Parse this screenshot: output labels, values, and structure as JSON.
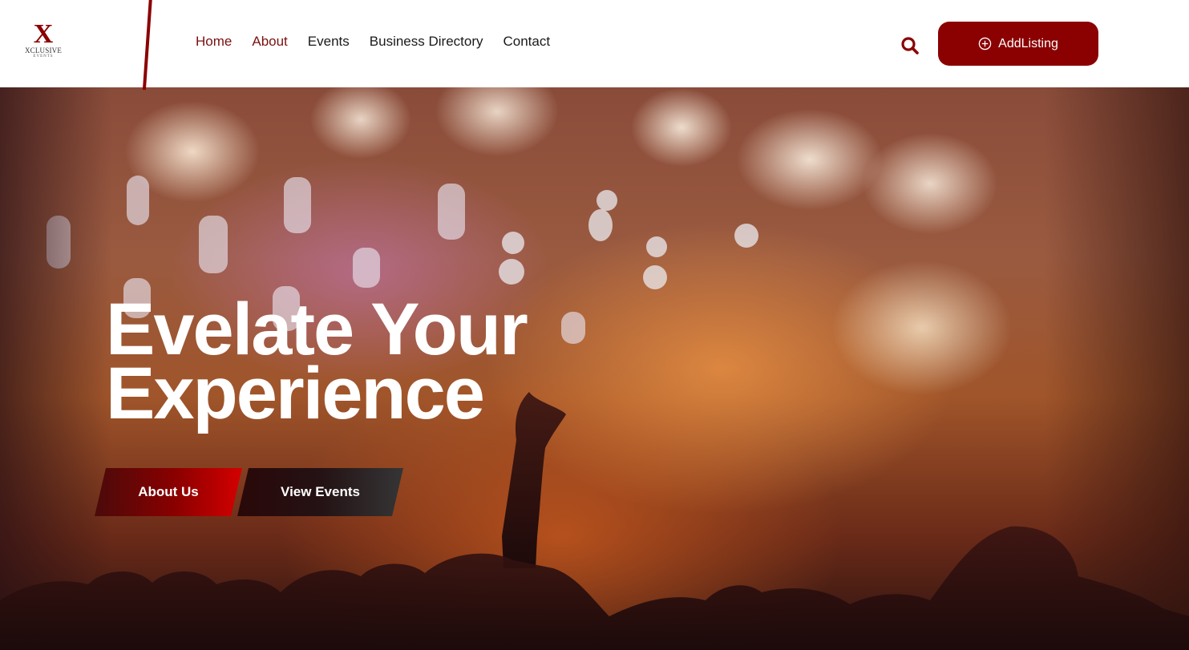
{
  "brand": {
    "logo_letter": "X",
    "logo_name": "XCLUSIVE",
    "logo_sub": "EVENTS",
    "accent_color": "#8b0000"
  },
  "nav": {
    "items": [
      {
        "label": "Home"
      },
      {
        "label": "About"
      },
      {
        "label": "Events"
      },
      {
        "label": "Business Directory"
      },
      {
        "label": "Contact"
      }
    ]
  },
  "header_actions": {
    "search_icon": "search-icon",
    "add_listing_label": "AddListing",
    "add_listing_icon": "plus-circle-icon"
  },
  "hero": {
    "title_line1": "Evelate Your",
    "title_line2": "Experience",
    "primary_button": "About Us",
    "secondary_button": "View Events"
  }
}
